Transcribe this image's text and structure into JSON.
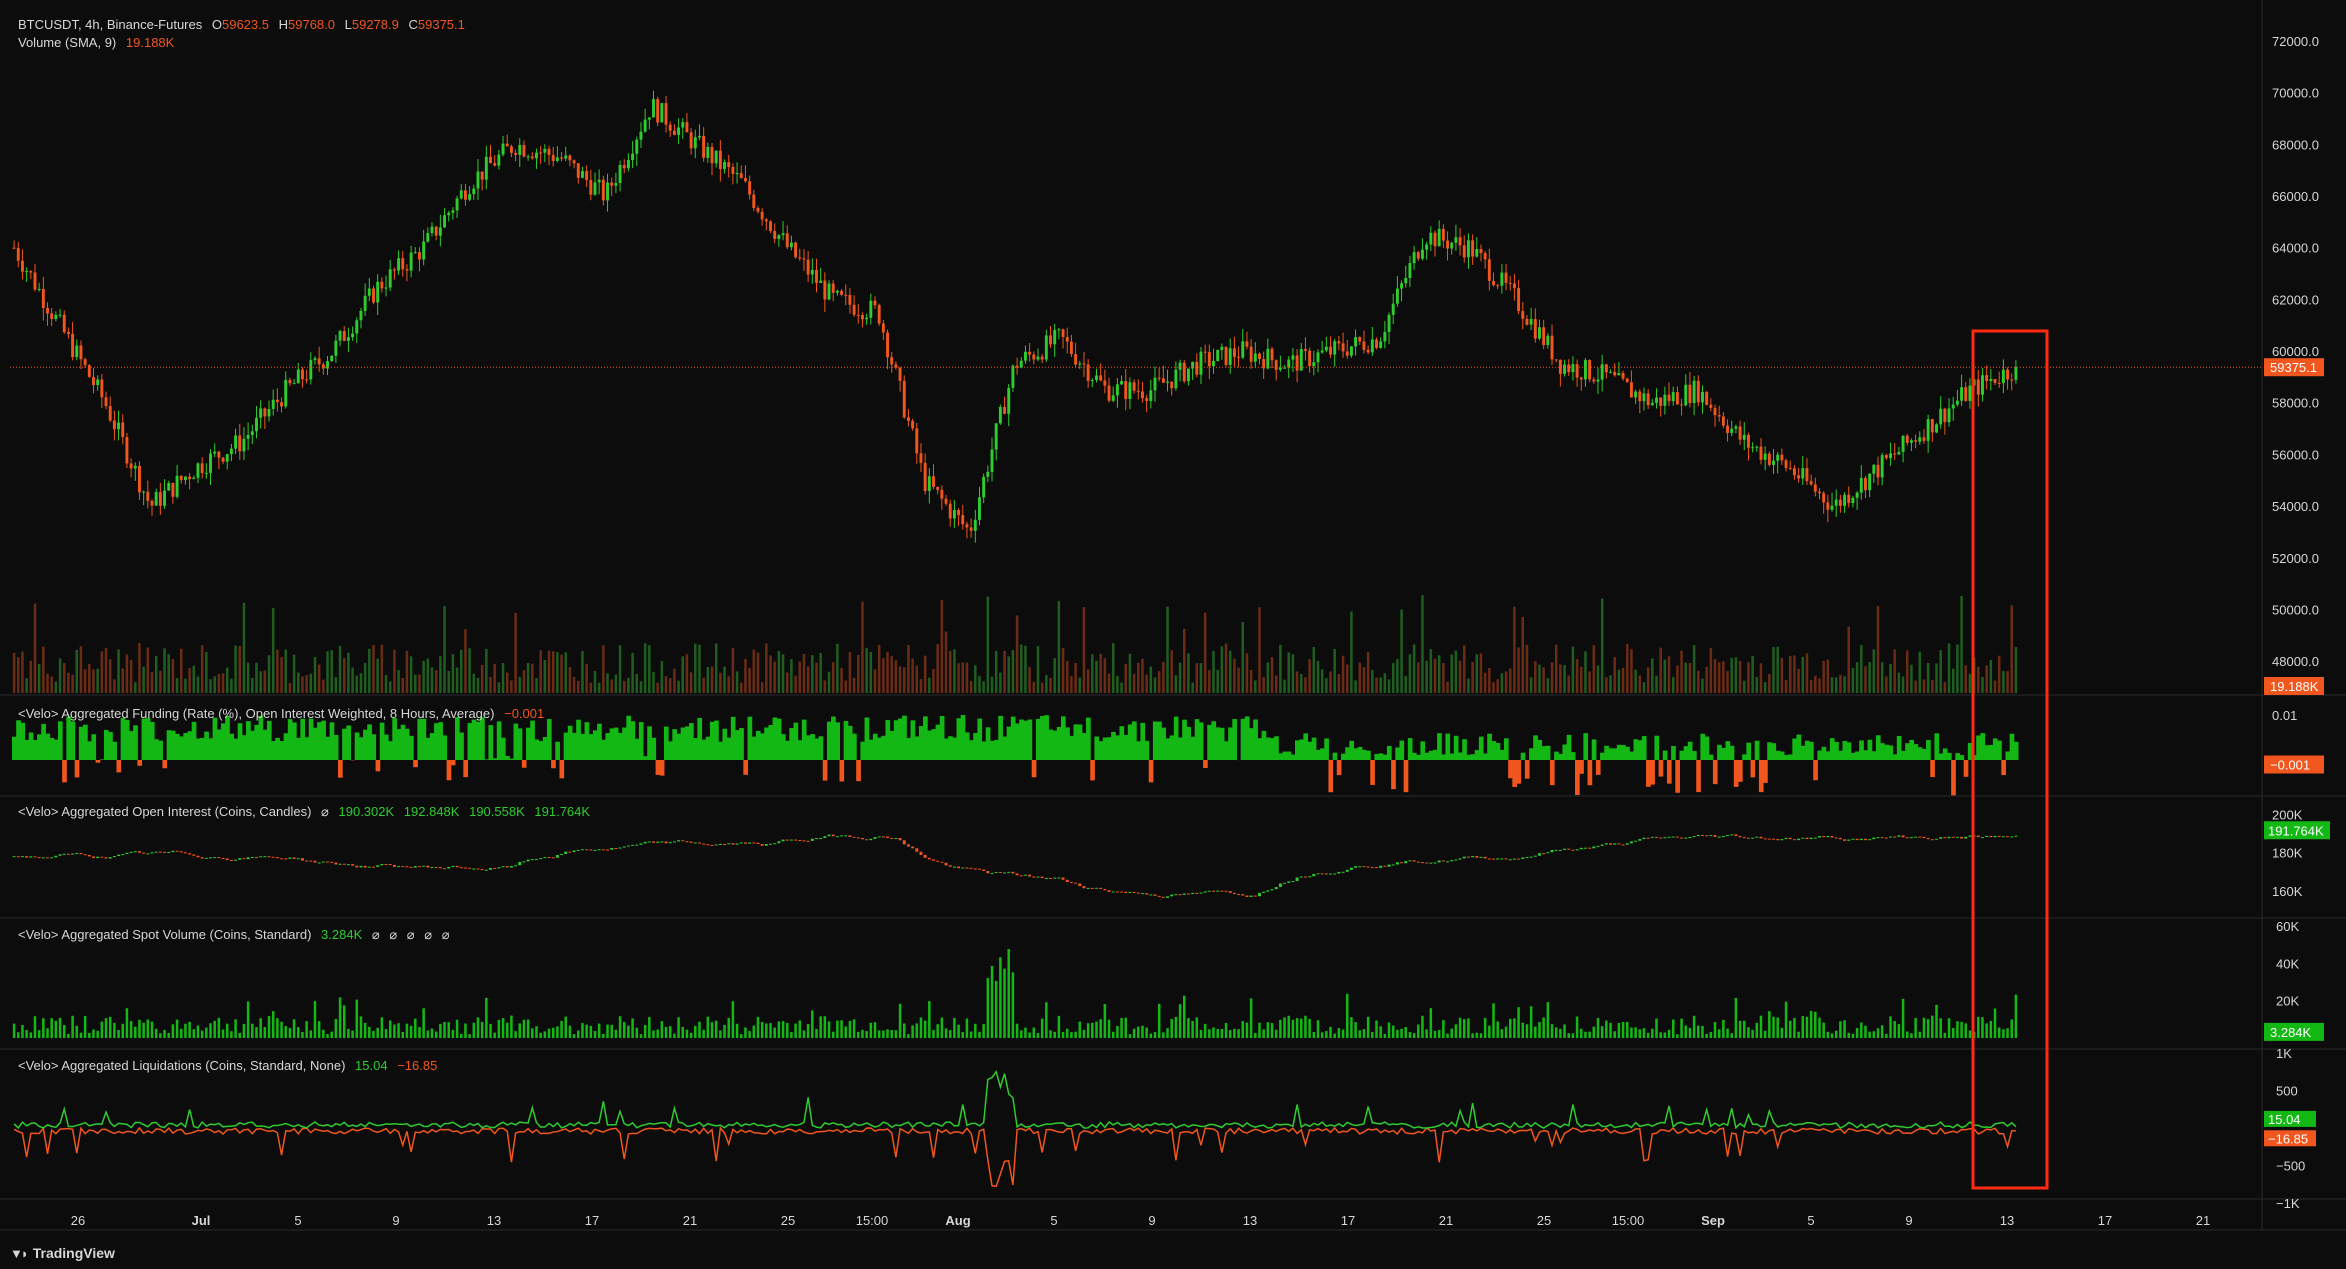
{
  "header": {
    "symbol": "BTCUSDT, 4h, Binance-Futures",
    "ohlc": {
      "o_label": "O",
      "o": "59623.5",
      "h_label": "H",
      "h": "59768.0",
      "l_label": "L",
      "l": "59278.9",
      "c_label": "C",
      "c": "59375.1"
    },
    "volume_label": "Volume (SMA, 9)",
    "volume_value": "19.188K"
  },
  "panes": [
    {
      "title": "<Velo> Aggregated Funding (Rate (%), Open Interest Weighted, 8 Hours, Average)",
      "values": [
        "−0.001"
      ],
      "value_colors": [
        "#f0561d"
      ]
    },
    {
      "title": "<Velo> Aggregated Open Interest (Coins, Candles)",
      "values": [
        "⌀",
        "190.302K",
        "192.848K",
        "190.558K",
        "191.764K"
      ],
      "value_colors": [
        "#d7d7d7",
        "#2ecc2e",
        "#2ecc2e",
        "#2ecc2e",
        "#2ecc2e"
      ]
    },
    {
      "title": "<Velo> Aggregated Spot Volume (Coins, Standard)",
      "values": [
        "3.284K",
        "⌀",
        "⌀",
        "⌀",
        "⌀",
        "⌀"
      ],
      "value_colors": [
        "#2ecc2e",
        "#d7d7d7",
        "#d7d7d7",
        "#d7d7d7",
        "#d7d7d7",
        "#d7d7d7"
      ]
    },
    {
      "title": "<Velo> Aggregated Liquidations (Coins, Standard, None)",
      "values": [
        "15.04",
        "−16.85"
      ],
      "value_colors": [
        "#2ecc2e",
        "#f0561d"
      ]
    }
  ],
  "price_axis": {
    "ticks": [
      "72000.0",
      "70000.0",
      "68000.0",
      "66000.0",
      "64000.0",
      "62000.0",
      "60000.0",
      "58000.0",
      "56000.0",
      "54000.0",
      "52000.0",
      "50000.0",
      "48000.0"
    ],
    "current_price": "59375.1",
    "current_volume": "19.188K"
  },
  "funding_axis": {
    "ticks": [
      "0.01"
    ],
    "current": "−0.001"
  },
  "oi_axis": {
    "ticks": [
      "200K",
      "180K",
      "160K"
    ],
    "current": "191.764K"
  },
  "spot_axis": {
    "ticks": [
      "60K",
      "40K",
      "20K"
    ],
    "current": "3.284K"
  },
  "liq_axis": {
    "ticks": [
      "1K",
      "500",
      "−500",
      "−1K"
    ],
    "current_pos": "15.04",
    "current_neg": "−16.85"
  },
  "time_axis": [
    "26",
    "Jul",
    "5",
    "9",
    "13",
    "17",
    "21",
    "25",
    "15:00",
    "Aug",
    "5",
    "9",
    "13",
    "17",
    "21",
    "25",
    "15:00",
    "Sep",
    "5",
    "9",
    "13",
    "17",
    "21"
  ],
  "branding": "TradingView",
  "colors": {
    "up": "#2ecc2e",
    "down": "#f0561d",
    "highlight": "#ff2a12",
    "background": "#0c0c0d",
    "grid": "#1e1e20",
    "text": "#d7d7d7"
  },
  "chart_data": {
    "type": "candlestick",
    "title": "BTCUSDT, 4h, Binance-Futures",
    "x": [
      "26",
      "Jul",
      "5",
      "9",
      "13",
      "17",
      "21",
      "25",
      "15:00",
      "Aug",
      "5",
      "9",
      "13",
      "17",
      "21",
      "25",
      "15:00",
      "Sep",
      "5",
      "9",
      "13"
    ],
    "series": [
      {
        "name": "close",
        "values": [
          64000,
          61000,
          58000,
          54000,
          55500,
          56500,
          58500,
          60000,
          62500,
          64000,
          66500,
          68000,
          67500,
          66000,
          69500,
          68000,
          66500,
          64000,
          62000,
          61500,
          55000,
          53000,
          59500,
          60500,
          58500,
          58500,
          59500,
          60000,
          59500,
          60000,
          60500,
          64500,
          64000,
          62000,
          59500,
          59000,
          58000,
          58500,
          56500,
          55500,
          54000,
          55500,
          57000,
          58500,
          59375
        ]
      }
    ],
    "ylim": [
      47000,
      72500
    ],
    "current_price": 59375.1,
    "funding": {
      "ylim": [
        -0.01,
        0.015
      ],
      "current": -0.001
    },
    "open_interest": {
      "ylim": [
        150000,
        205000
      ],
      "current": 191764
    },
    "spot_volume": {
      "ylim": [
        0,
        60000
      ],
      "current": 3284
    },
    "liquidations": {
      "ylim": [
        -1000,
        1000
      ],
      "current_long": 15.04,
      "current_short": -16.85
    }
  }
}
